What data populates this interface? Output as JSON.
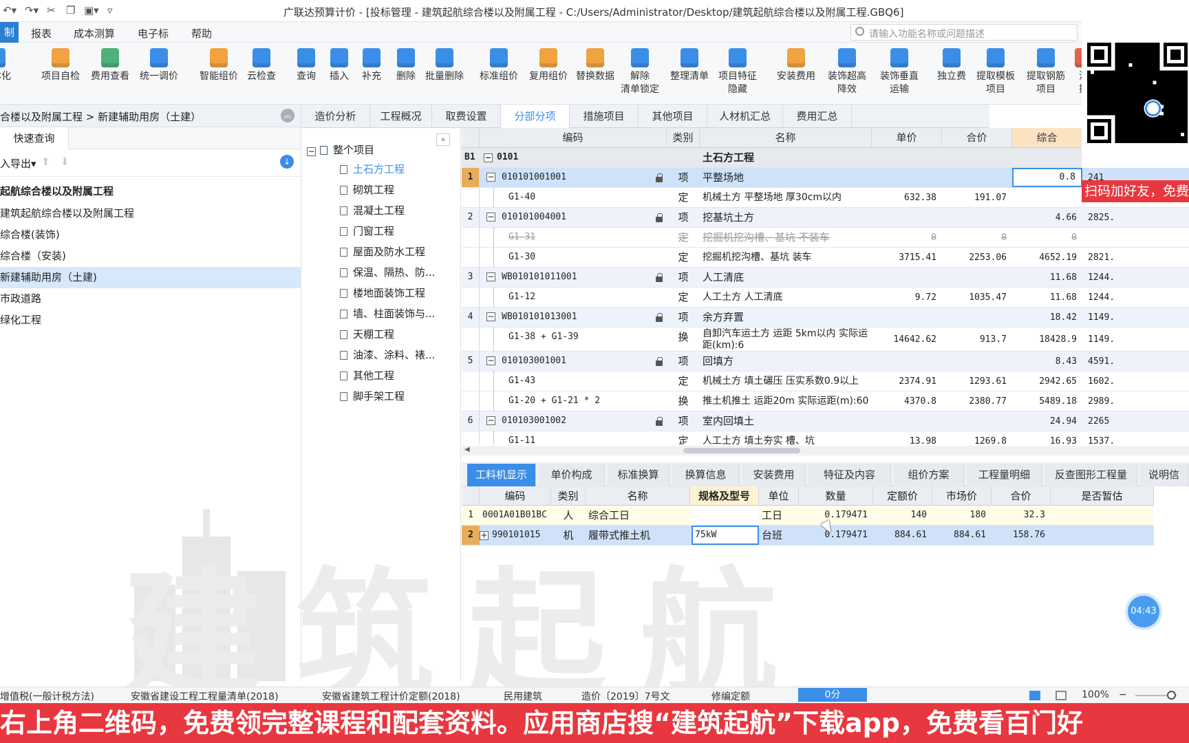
{
  "window": {
    "title": "广联达预算计价 - [投标管理 - 建筑起航综合楼以及附属工程 - C:/Users/Administrator/Desktop/建筑起航综合楼以及附属工程.GBQ6]"
  },
  "menu": [
    "制",
    "报表",
    "成本测算",
    "电子标",
    "帮助"
  ],
  "search_placeholder": "请输入功能名称或问题描述",
  "ribbon": [
    {
      "l1": "一体化",
      "l2": ""
    },
    {
      "l1": "项目自检",
      "l2": ""
    },
    {
      "l1": "费用查看",
      "l2": ""
    },
    {
      "l1": "统一调价",
      "l2": ""
    },
    {
      "l1": "智能组价",
      "l2": ""
    },
    {
      "l1": "云检查",
      "l2": ""
    },
    {
      "l1": "查询",
      "l2": ""
    },
    {
      "l1": "插入",
      "l2": ""
    },
    {
      "l1": "补充",
      "l2": ""
    },
    {
      "l1": "删除",
      "l2": ""
    },
    {
      "l1": "批量删除",
      "l2": ""
    },
    {
      "l1": "标准组价",
      "l2": ""
    },
    {
      "l1": "复用组价",
      "l2": ""
    },
    {
      "l1": "替换数据",
      "l2": ""
    },
    {
      "l1": "解除",
      "l2": "清单锁定"
    },
    {
      "l1": "整理清单",
      "l2": ""
    },
    {
      "l1": "项目特征",
      "l2": "隐藏"
    },
    {
      "l1": "安装费用",
      "l2": ""
    },
    {
      "l1": "装饰超高",
      "l2": "降效"
    },
    {
      "l1": "装饰垂直",
      "l2": "运输"
    },
    {
      "l1": "独立费",
      "l2": ""
    },
    {
      "l1": "提取模板",
      "l2": "项目"
    },
    {
      "l1": "提取钢筋",
      "l2": "项目"
    },
    {
      "l1": "混",
      "l2": "提"
    }
  ],
  "left": {
    "breadcrumb": "合楼以及附属工程 > 新建辅助用房（土建）",
    "tab": "快速查询",
    "tool_label": "入导出",
    "tree": [
      "起航综合楼以及附属工程",
      "建筑起航综合楼以及附属工程",
      "综合楼(装饰)",
      "综合楼（安装)",
      "新建辅助用房（土建)",
      "市政道路",
      "绿化工程"
    ]
  },
  "mid_tree": {
    "root": "整个项目",
    "items": [
      "土石方工程",
      "砌筑工程",
      "混凝土工程",
      "门窗工程",
      "屋面及防水工程",
      "保温、隔热、防...",
      "楼地面装饰工程",
      "墙、柱面装饰与...",
      "天棚工程",
      "油漆、涂料、裱...",
      "其他工程",
      "脚手架工程"
    ]
  },
  "tabs": [
    "造价分析",
    "工程概况",
    "取费设置",
    "分部分项",
    "措施项目",
    "其他项目",
    "人材机汇总",
    "费用汇总"
  ],
  "grid": {
    "headers": [
      "编码",
      "类别",
      "名称",
      "单价",
      "合价",
      "综合"
    ],
    "b1": {
      "tag": "B1",
      "code": "0101",
      "name": "土石方工程"
    },
    "rows": [
      {
        "no": "1",
        "code": "010101001001",
        "type": "项",
        "name": "平整场地",
        "price": "",
        "total": "",
        "comp": "0.8",
        "extra": "241",
        "kind": "item"
      },
      {
        "no": "",
        "code": "G1-40",
        "type": "定",
        "name": "机械土方 平整场地 厚30cm以内",
        "price": "632.38",
        "total": "191.07",
        "comp": "",
        "extra": "",
        "kind": "sub"
      },
      {
        "no": "2",
        "code": "010101004001",
        "type": "项",
        "name": "挖基坑土方",
        "price": "",
        "total": "",
        "comp": "4.66",
        "extra": "2825.",
        "kind": "item"
      },
      {
        "no": "",
        "code": "G1-31",
        "type": "定",
        "name": "挖掘机挖沟槽、基坑 不装车",
        "price": "0",
        "total": "0",
        "comp": "0",
        "extra": "",
        "kind": "strike"
      },
      {
        "no": "",
        "code": "G1-30",
        "type": "定",
        "name": "挖掘机挖沟槽、基坑 装车",
        "price": "3715.41",
        "total": "2253.06",
        "comp": "4652.19",
        "extra": "2821.",
        "kind": "sub"
      },
      {
        "no": "3",
        "code": "WB010101011001",
        "type": "项",
        "name": "人工清底",
        "price": "",
        "total": "",
        "comp": "11.68",
        "extra": "1244.",
        "kind": "item"
      },
      {
        "no": "",
        "code": "G1-12",
        "type": "定",
        "name": "人工土方 人工清底",
        "price": "9.72",
        "total": "1035.47",
        "comp": "11.68",
        "extra": "1244.",
        "kind": "sub"
      },
      {
        "no": "4",
        "code": "WB010101013001",
        "type": "项",
        "name": "余方弃置",
        "price": "",
        "total": "",
        "comp": "18.42",
        "extra": "1149.",
        "kind": "item"
      },
      {
        "no": "",
        "code": "G1-38 + G1-39",
        "type": "换",
        "name": "自卸汽车运土方 运距 5km以内  实际运",
        "name2": "距(km):6",
        "price": "14642.62",
        "total": "913.7",
        "comp": "18428.9",
        "extra": "1149.",
        "kind": "tall"
      },
      {
        "no": "5",
        "code": "010103001001",
        "type": "项",
        "name": "回填方",
        "price": "",
        "total": "",
        "comp": "8.43",
        "extra": "4591.",
        "kind": "item"
      },
      {
        "no": "",
        "code": "G1-43",
        "type": "定",
        "name": "机械土方 填土碾压 压实系数0.9以上",
        "price": "2374.91",
        "total": "1293.61",
        "comp": "2942.65",
        "extra": "1602.",
        "kind": "sub"
      },
      {
        "no": "",
        "code": "G1-20 + G1-21 * 2",
        "type": "换",
        "name": "推土机推土 运距20m  实际运距(m):60",
        "price": "4370.8",
        "total": "2380.77",
        "comp": "5489.18",
        "extra": "2989.",
        "kind": "sub"
      },
      {
        "no": "6",
        "code": "010103001002",
        "type": "项",
        "name": "室内回填土",
        "price": "",
        "total": "",
        "comp": "24.94",
        "extra": "2265",
        "kind": "item"
      },
      {
        "no": "",
        "code": "G1-11",
        "type": "定",
        "name": "人工土方 填土夯实 槽、坑",
        "price": "13.98",
        "total": "1269.8",
        "comp": "16.93",
        "extra": "1537.",
        "kind": "sub"
      }
    ]
  },
  "bottom_tabs": [
    "工料机显示",
    "单价构成",
    "标准换算",
    "换算信息",
    "安装费用",
    "特征及内容",
    "组价方案",
    "工程量明细",
    "反查图形工程量",
    "说明信"
  ],
  "bgrid": {
    "headers": [
      "编码",
      "类别",
      "名称",
      "规格及型号",
      "单位",
      "数量",
      "定额价",
      "市场价",
      "合价",
      "是否暂估"
    ],
    "rows": [
      {
        "no": "1",
        "code": "0001A01B01BC",
        "type": "人",
        "name": "综合工日",
        "spec": "",
        "unit": "工日",
        "qty": "0.179471",
        "quota": "140",
        "market": "180",
        "total": "32.3"
      },
      {
        "no": "2",
        "code": "990101015",
        "type": "机",
        "name": "履带式推土机",
        "spec": "75kW",
        "unit": "台班",
        "qty": "0.179471",
        "quota": "884.61",
        "market": "884.61",
        "total": "158.76"
      }
    ]
  },
  "watermark": "建筑起航",
  "status": [
    "增值税(一般计税方法)",
    "安徽省建设工程工程量清单(2018)",
    "安徽省建筑工程计价定额(2018)",
    "民用建筑",
    "造价〔2019〕7号文",
    "修编定额",
    "0分",
    "100%"
  ],
  "overlay": {
    "qr_tag": "扫码加好友，免费",
    "timer": "04:43",
    "banner": "右上角二维码，免费领完整课程和配套资料。应用商店搜“建筑起航”下载app，免费看百门好"
  }
}
